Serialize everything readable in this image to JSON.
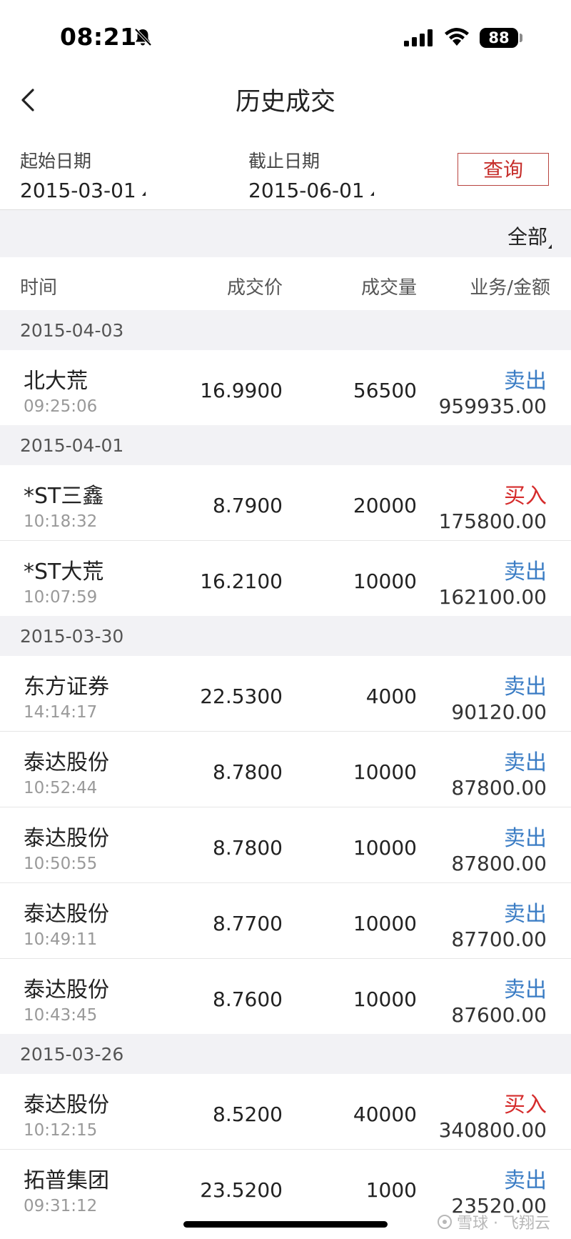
{
  "status_bar": {
    "time": "08:21",
    "battery": "88"
  },
  "nav": {
    "title": "历史成交"
  },
  "filter": {
    "start_label": "起始日期",
    "start_value": "2015-03-01",
    "end_label": "截止日期",
    "end_value": "2015-06-01",
    "query_label": "查询"
  },
  "category": {
    "selected": "全部"
  },
  "table_header": {
    "time": "时间",
    "price": "成交价",
    "quantity": "成交量",
    "business_amount": "业务/金额"
  },
  "groups": [
    {
      "date": "2015-04-03",
      "rows": [
        {
          "name": "北大荒",
          "time": "09:25:06",
          "price": "16.9900",
          "quantity": "56500",
          "action": "卖出",
          "action_type": "sell",
          "amount": "959935.00"
        }
      ]
    },
    {
      "date": "2015-04-01",
      "rows": [
        {
          "name": "*ST三鑫",
          "time": "10:18:32",
          "price": "8.7900",
          "quantity": "20000",
          "action": "买入",
          "action_type": "buy",
          "amount": "175800.00"
        },
        {
          "name": "*ST大荒",
          "time": "10:07:59",
          "price": "16.2100",
          "quantity": "10000",
          "action": "卖出",
          "action_type": "sell",
          "amount": "162100.00"
        }
      ]
    },
    {
      "date": "2015-03-30",
      "rows": [
        {
          "name": "东方证券",
          "time": "14:14:17",
          "price": "22.5300",
          "quantity": "4000",
          "action": "卖出",
          "action_type": "sell",
          "amount": "90120.00"
        },
        {
          "name": "泰达股份",
          "time": "10:52:44",
          "price": "8.7800",
          "quantity": "10000",
          "action": "卖出",
          "action_type": "sell",
          "amount": "87800.00"
        },
        {
          "name": "泰达股份",
          "time": "10:50:55",
          "price": "8.7800",
          "quantity": "10000",
          "action": "卖出",
          "action_type": "sell",
          "amount": "87800.00"
        },
        {
          "name": "泰达股份",
          "time": "10:49:11",
          "price": "8.7700",
          "quantity": "10000",
          "action": "卖出",
          "action_type": "sell",
          "amount": "87700.00"
        },
        {
          "name": "泰达股份",
          "time": "10:43:45",
          "price": "8.7600",
          "quantity": "10000",
          "action": "卖出",
          "action_type": "sell",
          "amount": "87600.00"
        }
      ]
    },
    {
      "date": "2015-03-26",
      "rows": [
        {
          "name": "泰达股份",
          "time": "10:12:15",
          "price": "8.5200",
          "quantity": "40000",
          "action": "买入",
          "action_type": "buy",
          "amount": "340800.00"
        },
        {
          "name": "拓普集团",
          "time": "09:31:12",
          "price": "23.5200",
          "quantity": "1000",
          "action": "卖出",
          "action_type": "sell",
          "amount": "23520.00"
        }
      ]
    }
  ],
  "colors": {
    "sell": "#3a7cc4",
    "buy": "#d52b2b",
    "query_border": "#b8443f"
  },
  "watermark": "雪球 · 飞翔云"
}
